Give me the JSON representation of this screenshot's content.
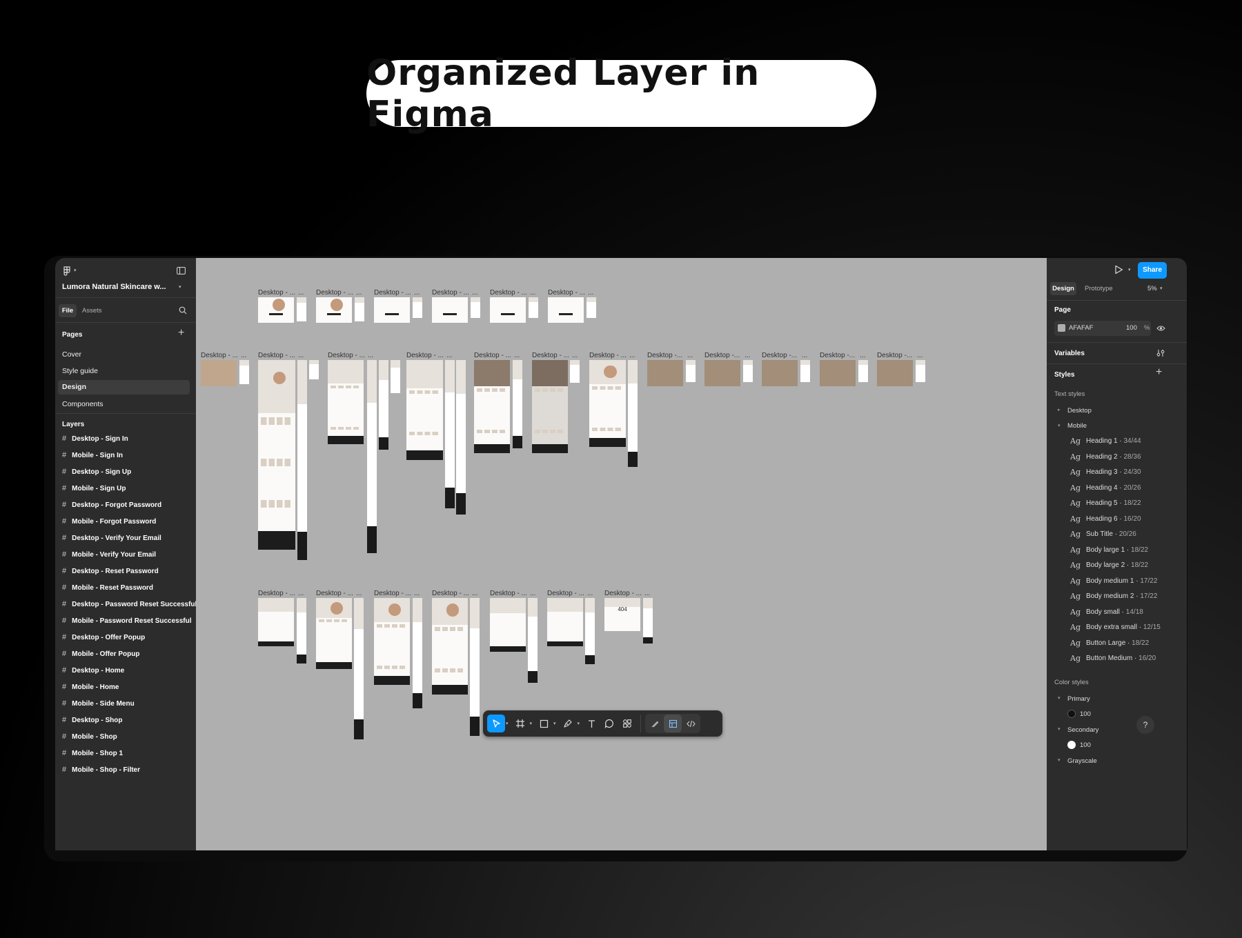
{
  "headline": "Organized Layer in Figma",
  "left": {
    "file_name": "Lumora Natural Skincare w...",
    "tabs": {
      "file": "File",
      "assets": "Assets"
    },
    "pages_title": "Pages",
    "pages": [
      "Cover",
      "Style guide",
      "Design",
      "Components"
    ],
    "selected_page": "Design",
    "layers_title": "Layers",
    "layers": [
      "Desktop - Sign In",
      "Mobile - Sign In",
      "Desktop - Sign Up",
      "Mobile - Sign Up",
      "Desktop - Forgot Password",
      "Mobile - Forgot Password",
      "Desktop - Verify Your Email",
      "Mobile - Verify Your Email",
      "Desktop - Reset Password",
      "Mobile - Reset Password",
      "Desktop - Password Reset Successful",
      "Mobile - Password Reset Successful",
      "Desktop - Offer Popup",
      "Mobile - Offer Popup",
      "Desktop - Home",
      "Mobile - Home",
      "Mobile - Side Menu",
      "Desktop - Shop",
      "Mobile - Shop",
      "Mobile - Shop 1",
      "Mobile - Shop - Filter"
    ]
  },
  "canvas": {
    "frame_label_full": "Desktop - ...",
    "frame_label_short": "Desktop -...",
    "not_found_text": "404",
    "background": "#AFAFAF"
  },
  "right": {
    "share_label": "Share",
    "tabs": {
      "design": "Design",
      "prototype": "Prototype"
    },
    "zoom": "5%",
    "page_title": "Page",
    "page_color_hex": "AFAFAF",
    "page_opacity": "100",
    "page_opacity_unit": "%",
    "variables_title": "Variables",
    "styles_title": "Styles",
    "text_styles_title": "Text styles",
    "groups": {
      "desktop": "Desktop",
      "mobile": "Mobile"
    },
    "text_style_glyph": "Ag",
    "text_styles": [
      {
        "name": "Heading 1",
        "size": "34/44"
      },
      {
        "name": "Heading 2",
        "size": "28/36"
      },
      {
        "name": "Heading 3",
        "size": "24/30"
      },
      {
        "name": "Heading 4",
        "size": "20/26"
      },
      {
        "name": "Heading 5",
        "size": "18/22"
      },
      {
        "name": "Heading 6",
        "size": "16/20"
      },
      {
        "name": "Sub Title",
        "size": "20/26"
      },
      {
        "name": "Body large 1",
        "size": "18/22"
      },
      {
        "name": "Body large 2",
        "size": "18/22"
      },
      {
        "name": "Body medium 1",
        "size": "17/22"
      },
      {
        "name": "Body medium 2",
        "size": "17/22"
      },
      {
        "name": "Body small",
        "size": "14/18"
      },
      {
        "name": "Body extra small",
        "size": "12/15"
      },
      {
        "name": "Button Large",
        "size": "18/22"
      },
      {
        "name": "Button Medium",
        "size": "16/20"
      }
    ],
    "color_styles_title": "Color styles",
    "color_groups": [
      {
        "name": "Primary",
        "swatch": "100",
        "color": "#111111"
      },
      {
        "name": "Secondary",
        "swatch": "100",
        "color": "#FFFFFF"
      },
      {
        "name": "Grayscale"
      }
    ],
    "help_label": "?"
  },
  "colors": {
    "accent": "#0D99FF",
    "panel": "#2C2C2C"
  }
}
